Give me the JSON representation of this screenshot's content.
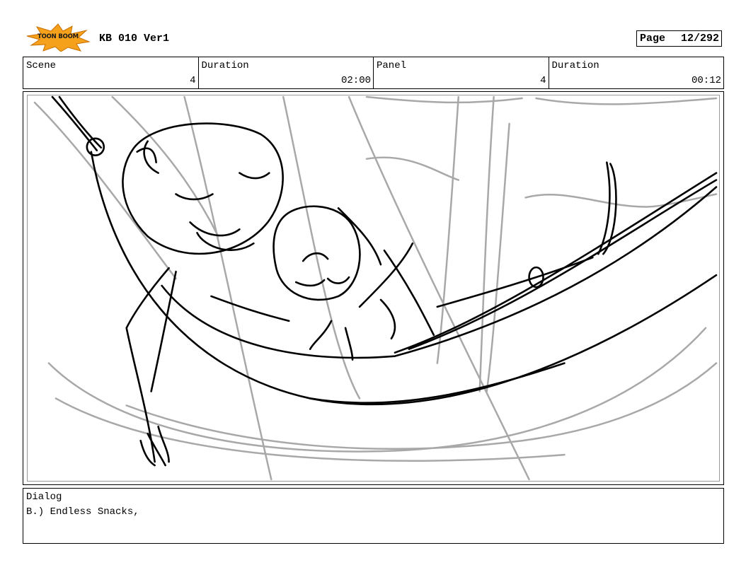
{
  "header": {
    "logo_text": "TOON BOOM",
    "title": "KB 010 Ver1",
    "page_label": "Page",
    "page_value": "12/292"
  },
  "info": {
    "scene": {
      "label": "Scene",
      "value": "4"
    },
    "scene_duration": {
      "label": "Duration",
      "value": "02:00"
    },
    "panel": {
      "label": "Panel",
      "value": "4"
    },
    "panel_duration": {
      "label": "Duration",
      "value": "00:12"
    }
  },
  "dialog": {
    "label": "Dialog",
    "text": "B.) Endless Snacks,"
  },
  "colors": {
    "logo_burst": "#f5a11c",
    "sketch_ink": "#000000",
    "sketch_rough": "#a8a8a8"
  }
}
